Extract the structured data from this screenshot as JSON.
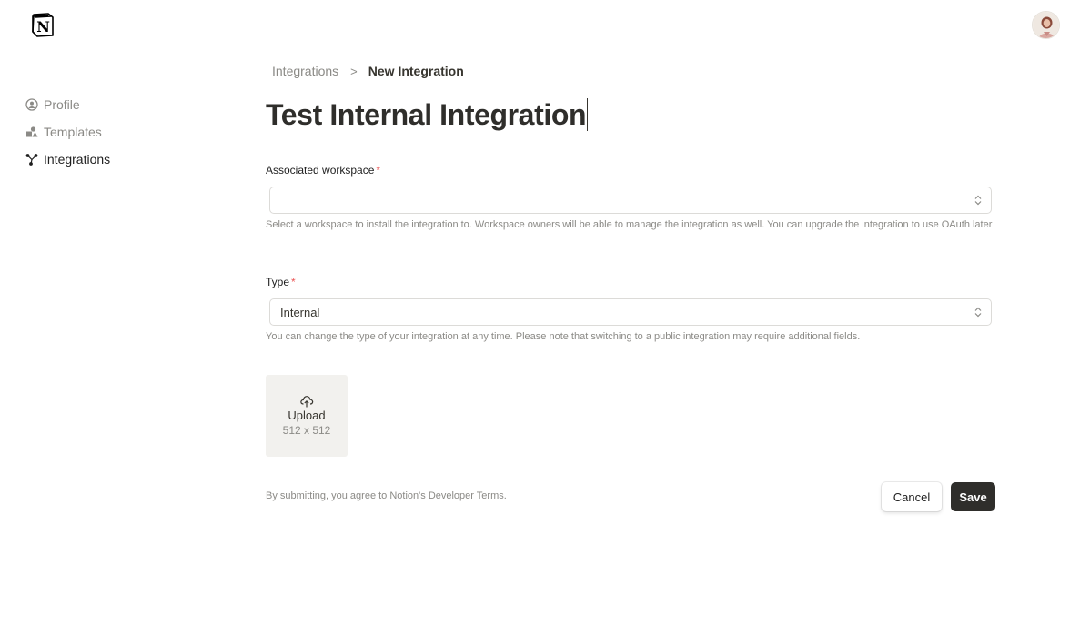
{
  "sidebar": {
    "items": [
      {
        "label": "Profile",
        "icon": "profile-icon",
        "active": false
      },
      {
        "label": "Templates",
        "icon": "templates-icon",
        "active": false
      },
      {
        "label": "Integrations",
        "icon": "integrations-icon",
        "active": true
      }
    ]
  },
  "breadcrumb": {
    "parent": "Integrations",
    "separator": ">",
    "current": "New Integration"
  },
  "page": {
    "title": "Test Internal Integration"
  },
  "workspace_field": {
    "label": "Associated workspace",
    "required_mark": "*",
    "value": "",
    "help": "Select a workspace to install the integration to. Workspace owners will be able to manage the integration as well. You can upgrade the integration to use OAuth later"
  },
  "type_field": {
    "label": "Type",
    "required_mark": "*",
    "value": "Internal",
    "help": "You can change the type of your integration at any time. Please note that switching to a public integration may require additional fields."
  },
  "upload": {
    "label": "Upload",
    "size": "512 x 512",
    "icon": "cloud-upload-icon"
  },
  "footer": {
    "terms_prefix": "By submitting, you agree to Notion's ",
    "terms_link": "Developer Terms",
    "terms_suffix": ".",
    "cancel_label": "Cancel",
    "save_label": "Save"
  },
  "colors": {
    "required": "#eb5757",
    "save_bg": "#2f2e2b",
    "muted_text": "#8b8a86"
  }
}
